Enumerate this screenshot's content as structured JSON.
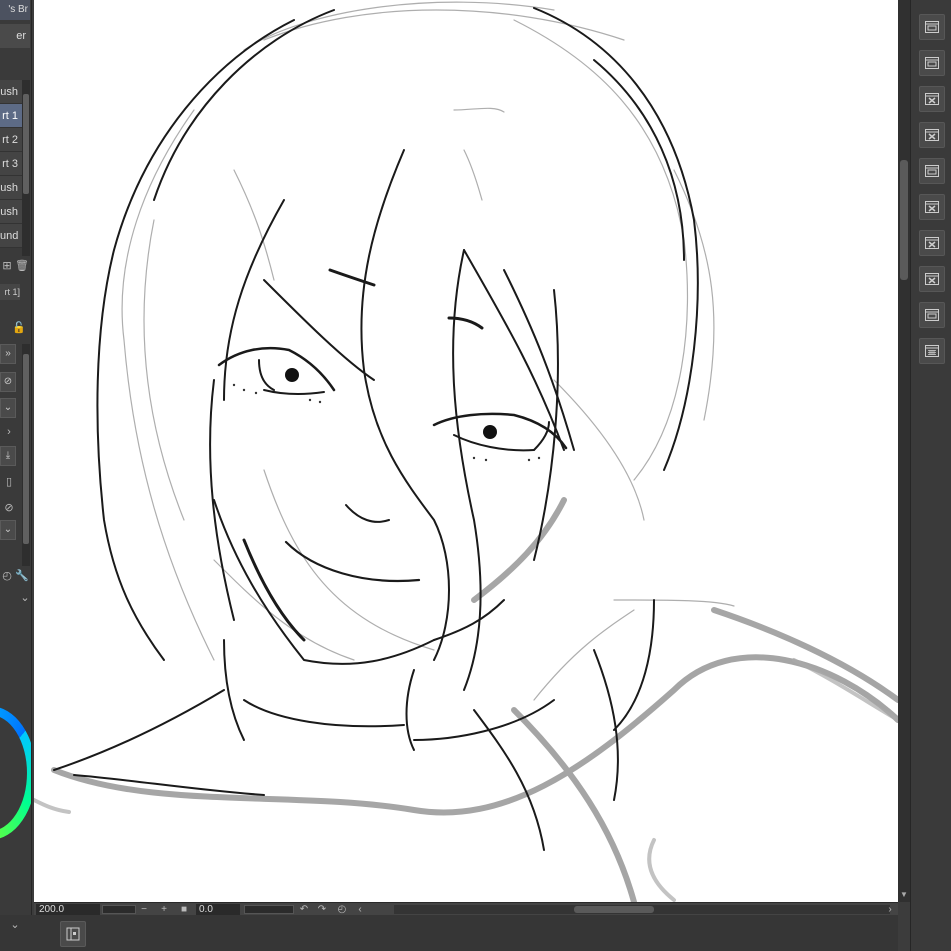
{
  "left_panel": {
    "tab_title": "'s Br",
    "tab2_label": "er",
    "subtools": [
      {
        "label": "ush",
        "active": false
      },
      {
        "label": "rt 1",
        "active": true
      },
      {
        "label": "rt 2",
        "active": false
      },
      {
        "label": "rt 3",
        "active": false
      },
      {
        "label": "ush",
        "active": false
      },
      {
        "label": "ush",
        "active": false
      },
      {
        "label": "und",
        "active": false
      }
    ],
    "property_label": "rt 1]"
  },
  "status_bar": {
    "zoom_value": "200.0",
    "angle_value": "0.0",
    "zoom_out": "−",
    "zoom_in": "+"
  },
  "colors": {
    "canvas": "#ffffff",
    "panel": "#3a3a3a",
    "active_item": "#5d6b86",
    "color_ring": "#00c8ff"
  },
  "right_tools": [
    {
      "name": "layer-window-icon"
    },
    {
      "name": "layer-window-icon"
    },
    {
      "name": "close-window-icon"
    },
    {
      "name": "close-window-icon"
    },
    {
      "name": "layer-window-icon"
    },
    {
      "name": "close-window-icon"
    },
    {
      "name": "close-window-icon"
    },
    {
      "name": "close-window-icon"
    },
    {
      "name": "layer-window-icon"
    },
    {
      "name": "grid-window-icon"
    }
  ]
}
